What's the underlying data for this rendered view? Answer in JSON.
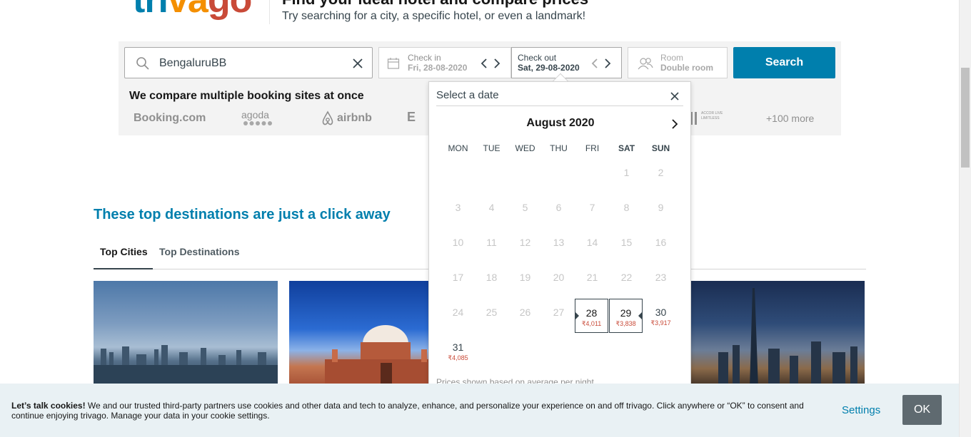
{
  "header": {
    "logo_part1": "tri",
    "logo_part2": "va",
    "logo_part3": "go",
    "heading": "Find your ideal hotel and compare prices",
    "hint": "Try searching for a city, a specific hotel, or even a landmark!"
  },
  "search": {
    "destination_value": "BengaluruBB",
    "checkin_label": "Check in",
    "checkin_value": "Fri, 28-08-2020",
    "checkout_label": "Check out",
    "checkout_value": "Sat, 29-08-2020",
    "room_label": "Room",
    "room_value": "Double room",
    "search_button": "Search"
  },
  "compare": {
    "text": "We compare multiple booking sites at once",
    "partners": [
      "Booking.com",
      "agoda",
      "airbnb",
      "E",
      "ACCOR LIVE LIMITLESS"
    ],
    "more": "+100 more"
  },
  "destinations": {
    "title": "These top destinations are just a click away",
    "tabs": [
      "Top Cities",
      "Top Destinations"
    ]
  },
  "datepicker": {
    "title": "Select a date",
    "month": "August 2020",
    "weekdays": [
      "MON",
      "TUE",
      "WED",
      "THU",
      "FRI",
      "SAT",
      "SUN"
    ],
    "days": [
      {
        "d": "1"
      },
      {
        "d": "2"
      },
      {
        "d": "3"
      },
      {
        "d": "4"
      },
      {
        "d": "5"
      },
      {
        "d": "6"
      },
      {
        "d": "7"
      },
      {
        "d": "8"
      },
      {
        "d": "9"
      },
      {
        "d": "10"
      },
      {
        "d": "11"
      },
      {
        "d": "12"
      },
      {
        "d": "13"
      },
      {
        "d": "14"
      },
      {
        "d": "15"
      },
      {
        "d": "16"
      },
      {
        "d": "17"
      },
      {
        "d": "18"
      },
      {
        "d": "19"
      },
      {
        "d": "20"
      },
      {
        "d": "21"
      },
      {
        "d": "22"
      },
      {
        "d": "23"
      },
      {
        "d": "24"
      },
      {
        "d": "25"
      },
      {
        "d": "26"
      },
      {
        "d": "27"
      },
      {
        "d": "28",
        "price": "₹4,011"
      },
      {
        "d": "29",
        "price": "₹3,838"
      },
      {
        "d": "30",
        "price": "₹3,917"
      },
      {
        "d": "31",
        "price": "₹4,085"
      }
    ],
    "note": "Prices shown based on average per night"
  },
  "cookie": {
    "lead": "Let’s talk cookies!",
    "text": " We and our trusted third-party partners use cookies and other data and tech to analyze, enhance, and personalize your experience on and off trivago. Click anywhere or “OK” to consent and continue enjoying trivago. Manage your data in your cookie settings.",
    "settings": "Settings",
    "ok": "OK"
  },
  "colors": {
    "brand_blue": "#007fad",
    "brand_orange": "#f48f00",
    "brand_red": "#c94a38",
    "price_red": "#c94a38"
  }
}
